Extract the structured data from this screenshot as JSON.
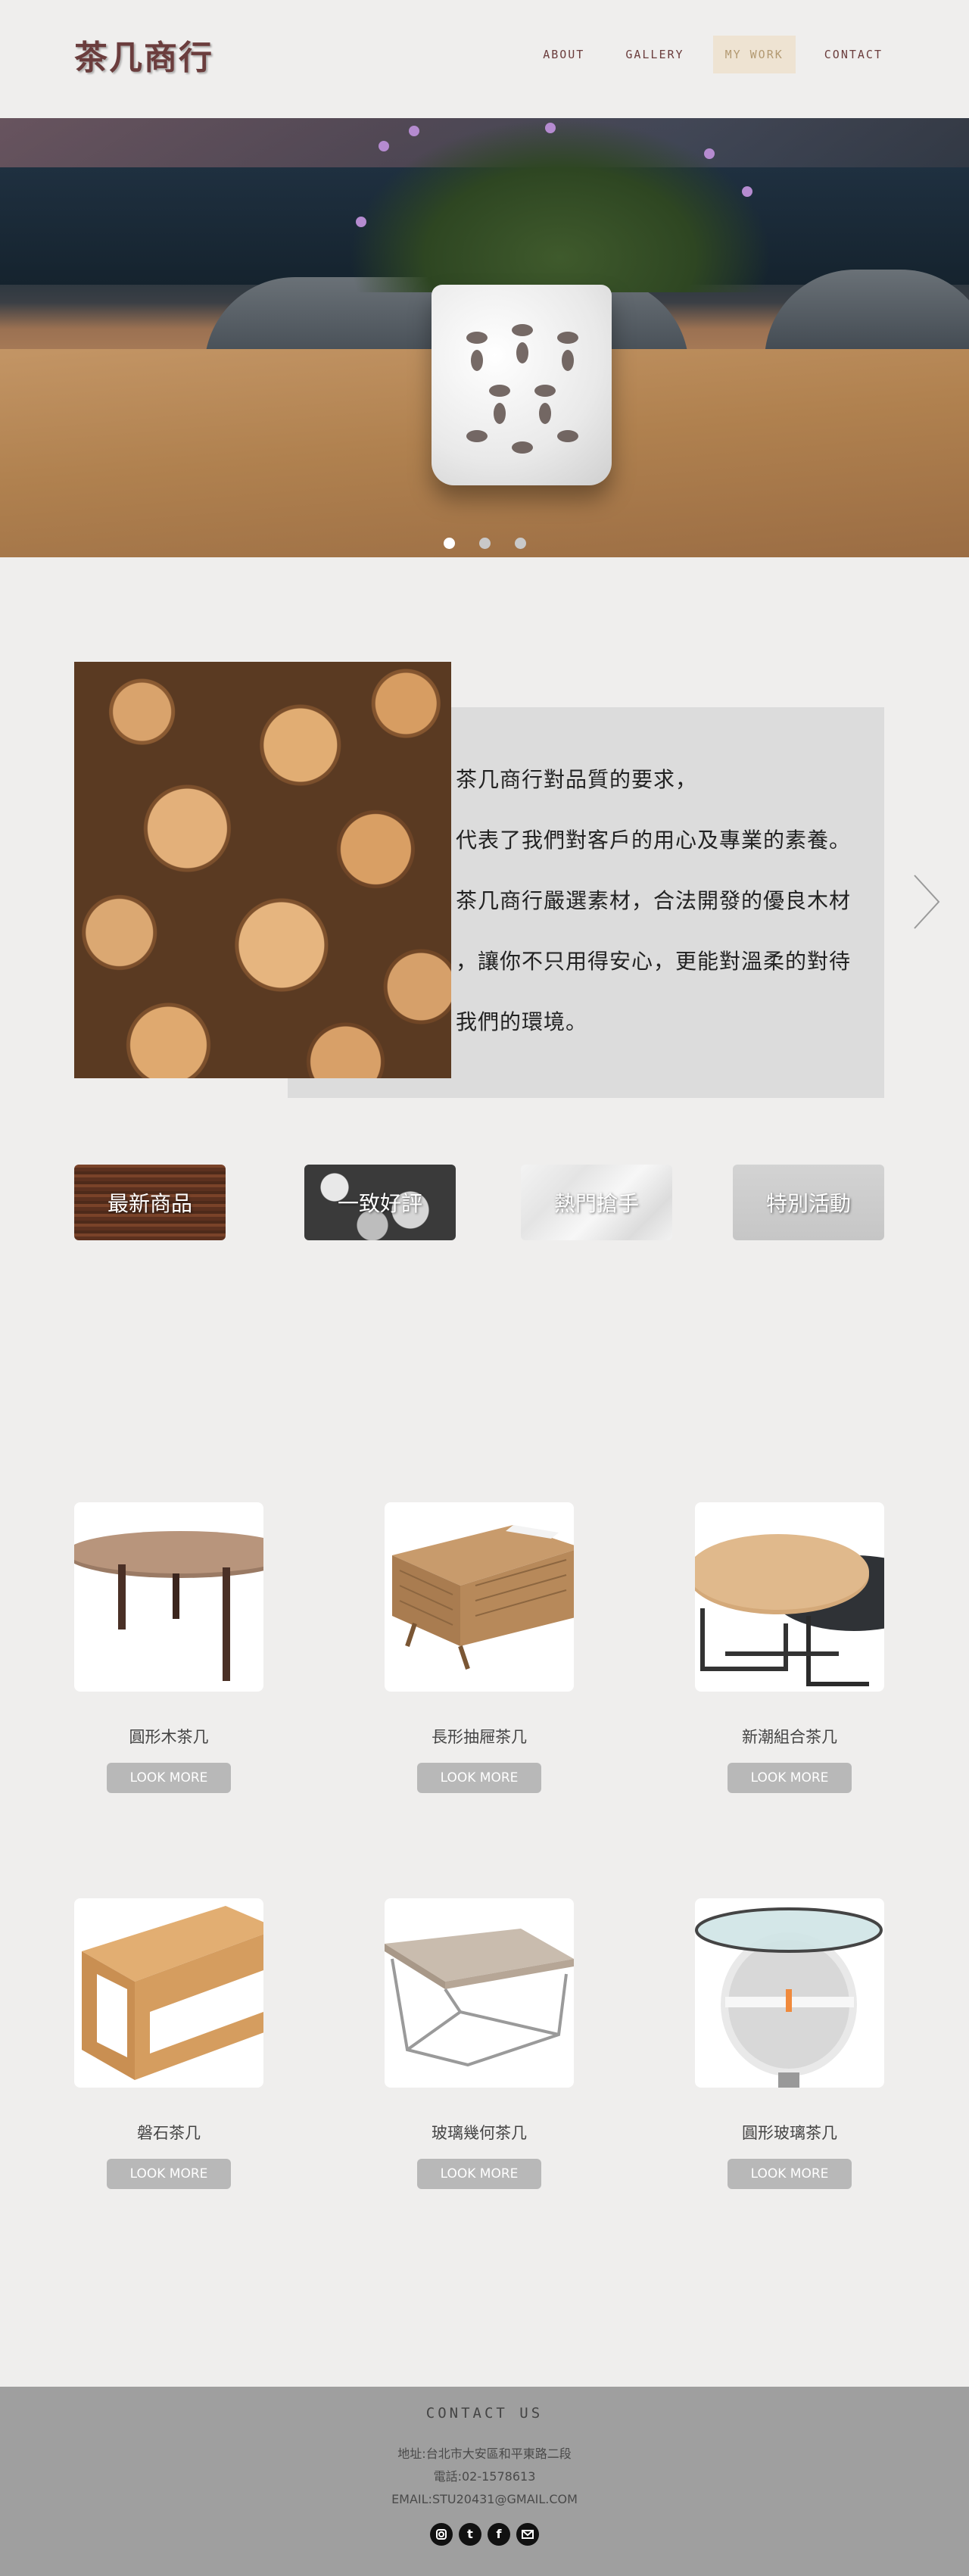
{
  "header": {
    "logo": "茶几商行",
    "nav": [
      "ABOUT",
      "GALLERY",
      "MY WORK",
      "CONTACT"
    ],
    "active_nav": "MY WORK"
  },
  "hero": {
    "slide_count": 3,
    "active_slide": 1
  },
  "about": {
    "lines": [
      "茶几商行對品質的要求，",
      "代表了我們對客戶的用心及專業的素養。",
      "茶几商行嚴選素材，合法開發的優良木材",
      "，讓你不只用得安心，更能對溫柔的對待",
      "我們的環境。"
    ]
  },
  "categories": [
    "最新商品",
    "一致好評",
    "熱門搶手",
    "特別活動"
  ],
  "products": [
    {
      "name": "圓形木茶几",
      "button": "LOOK MORE"
    },
    {
      "name": "長形抽屜茶几",
      "button": "LOOK MORE"
    },
    {
      "name": "新潮組合茶几",
      "button": "LOOK MORE"
    },
    {
      "name": "磐石茶几",
      "button": "LOOK MORE"
    },
    {
      "name": "玻璃幾何茶几",
      "button": "LOOK MORE"
    },
    {
      "name": "圓形玻璃茶几",
      "button": "LOOK MORE"
    }
  ],
  "footer": {
    "title": "CONTACT US",
    "address": "地址:台北市大安區和平東路二段",
    "phone": "電話:02-1578613",
    "email": "EMAIL:STU20431@GMAIL.COM",
    "social": [
      "instagram-icon",
      "tumblr-icon",
      "facebook-icon",
      "mail-icon"
    ]
  },
  "colors": {
    "brand": "#6b3d3d",
    "background": "#efeeed",
    "active_nav_bg": "#eee3d2",
    "button": "#b8b8b8",
    "footer_bg": "#9f9f9f"
  }
}
